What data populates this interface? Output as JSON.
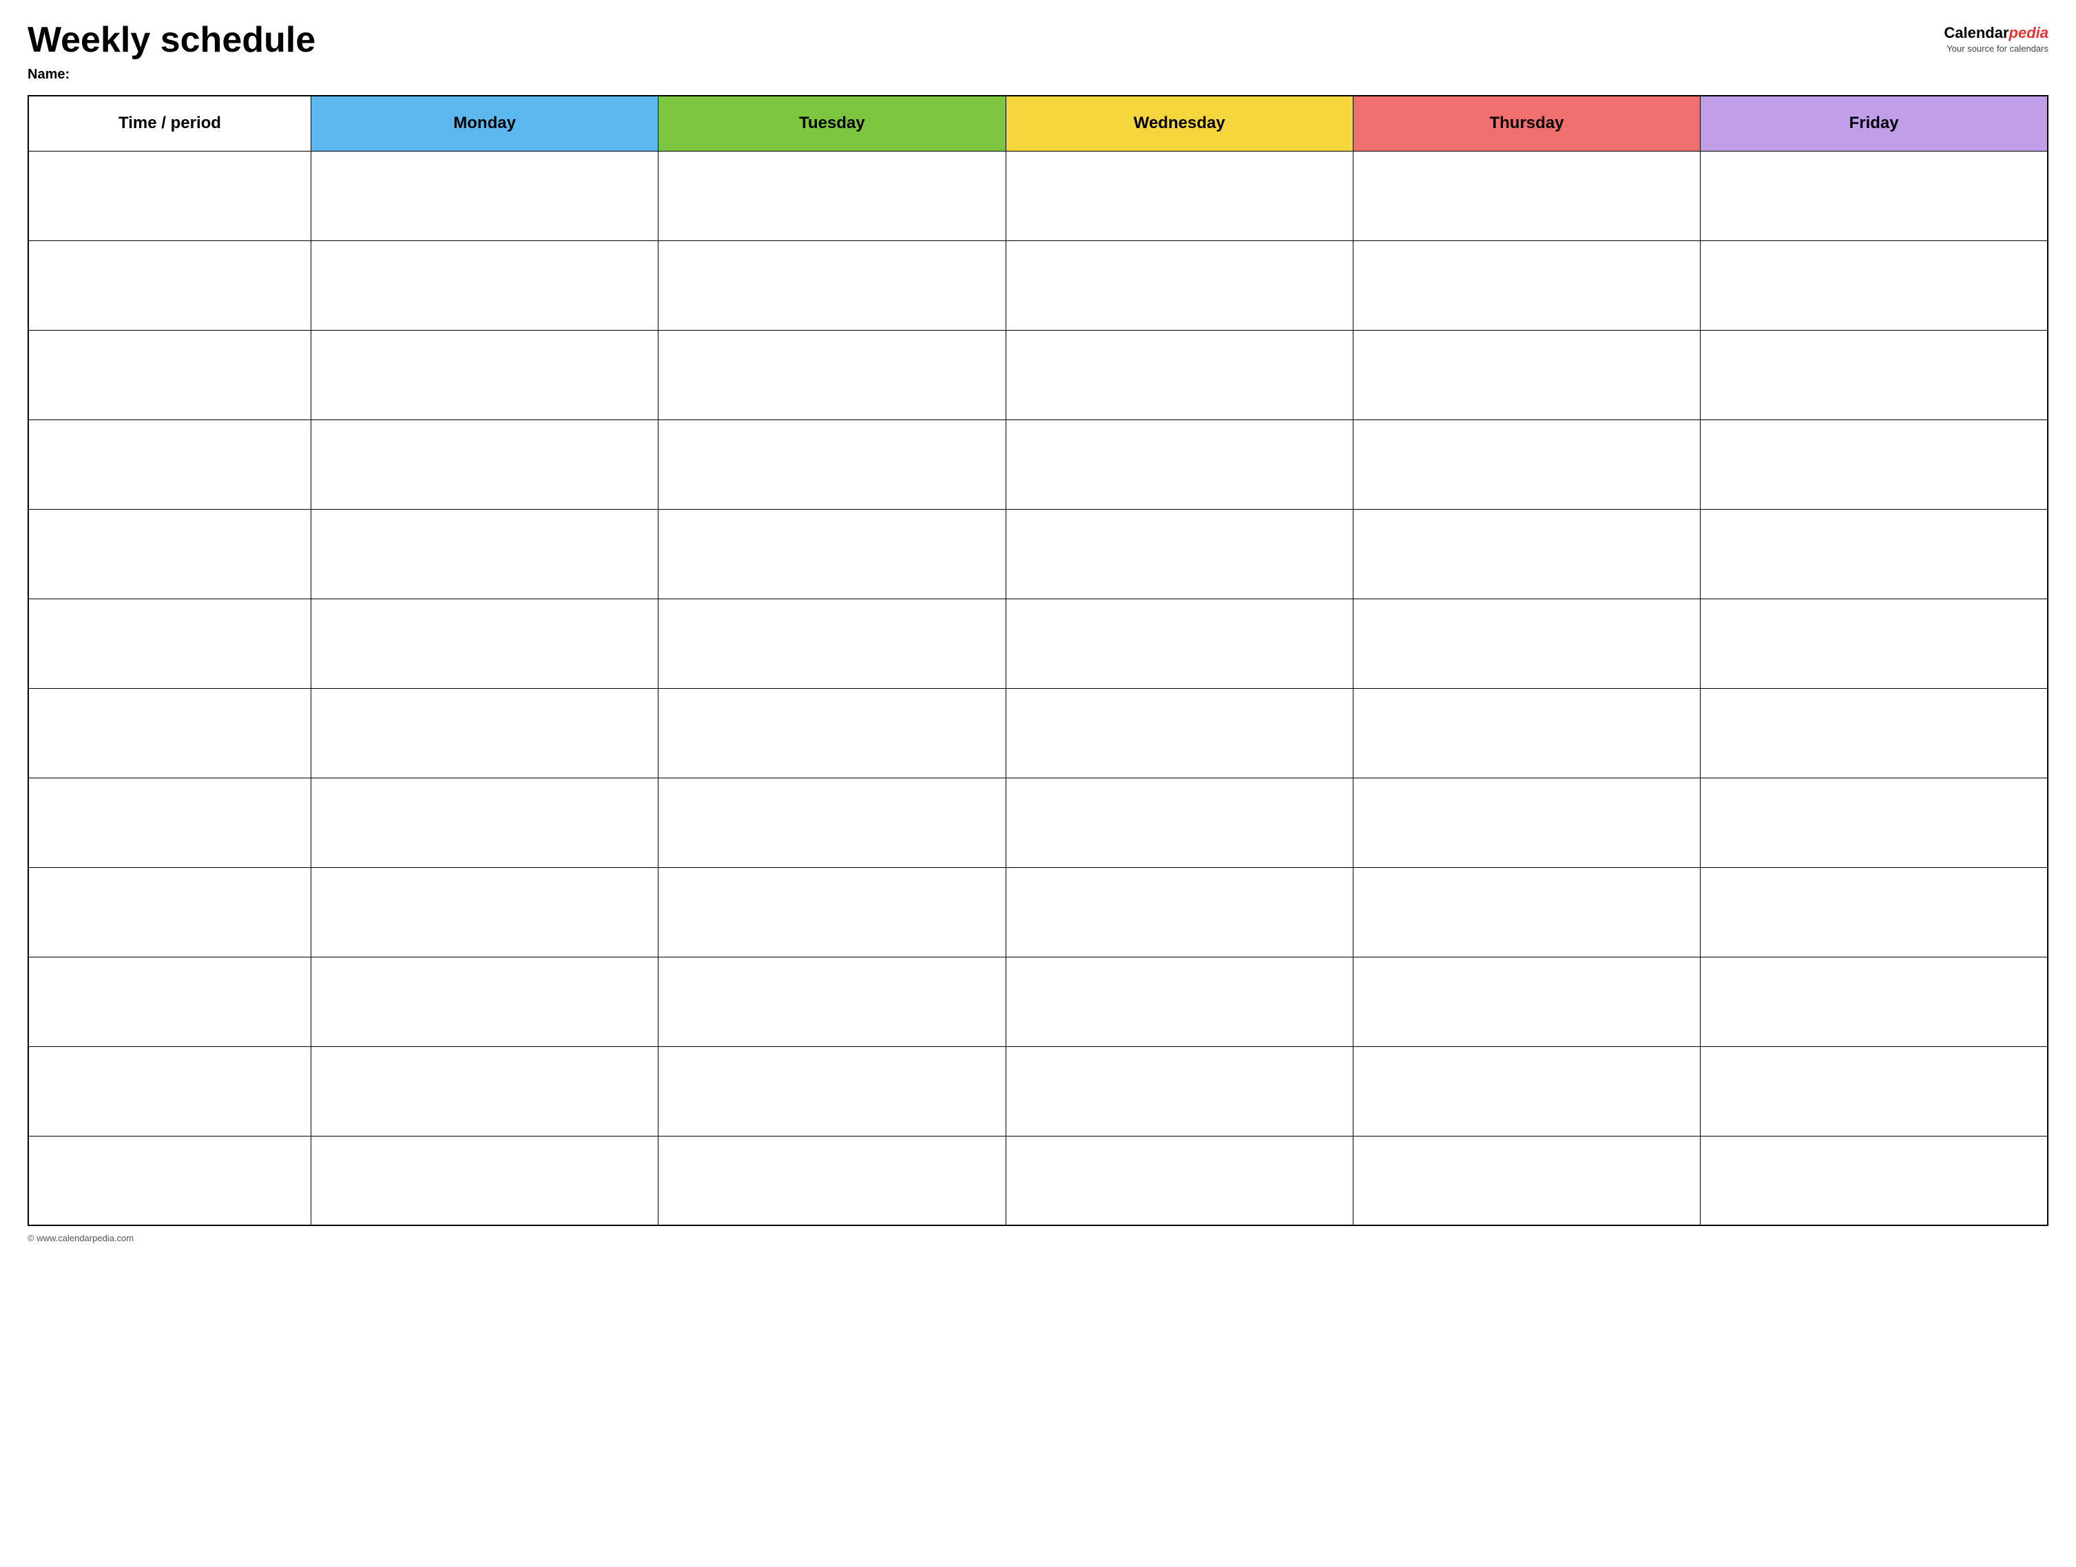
{
  "header": {
    "title": "Weekly schedule",
    "name_label": "Name:",
    "logo": {
      "text_calendar": "Calendar",
      "text_pedia": "pedia",
      "tagline": "Your source for calendars"
    }
  },
  "table": {
    "columns": [
      {
        "id": "time",
        "label": "Time / period",
        "color": "#ffffff"
      },
      {
        "id": "monday",
        "label": "Monday",
        "color": "#5eb8f0"
      },
      {
        "id": "tuesday",
        "label": "Tuesday",
        "color": "#7dc740"
      },
      {
        "id": "wednesday",
        "label": "Wednesday",
        "color": "#f5d63d"
      },
      {
        "id": "thursday",
        "label": "Thursday",
        "color": "#f07070"
      },
      {
        "id": "friday",
        "label": "Friday",
        "color": "#c09ee8"
      }
    ],
    "row_count": 12
  },
  "footer": {
    "url": "© www.calendarpedia.com"
  }
}
